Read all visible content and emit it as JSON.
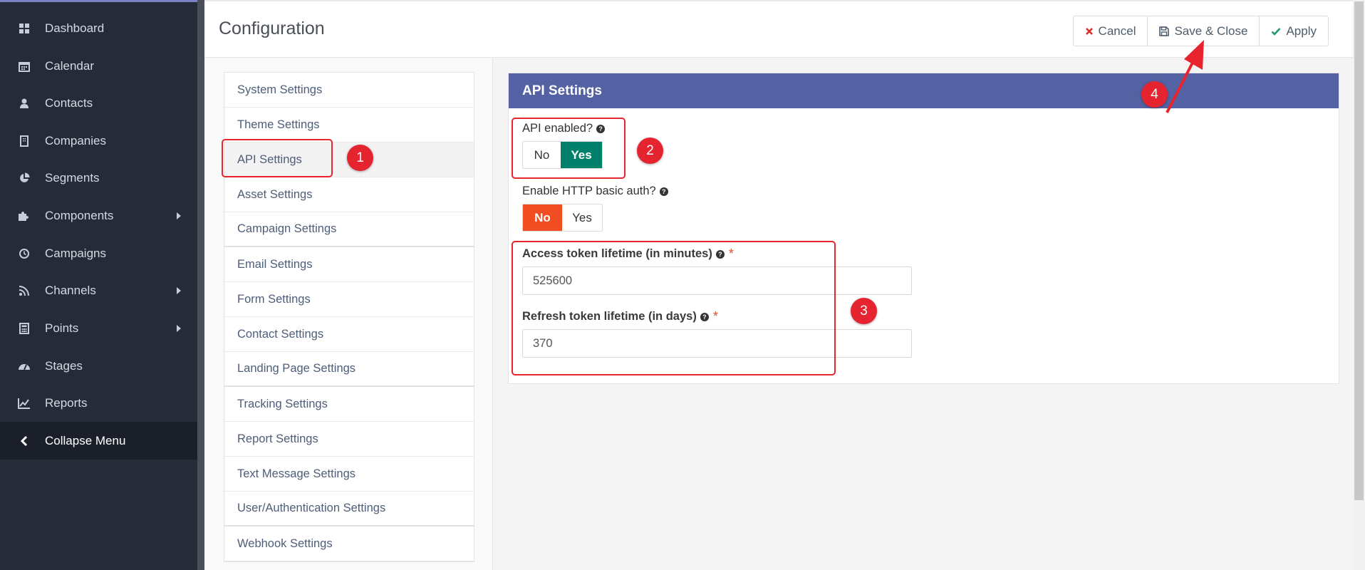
{
  "sidebar": {
    "items": [
      {
        "label": "Dashboard",
        "icon": "dashboard-icon"
      },
      {
        "label": "Calendar",
        "icon": "calendar-icon"
      },
      {
        "label": "Contacts",
        "icon": "user-icon"
      },
      {
        "label": "Companies",
        "icon": "building-icon"
      },
      {
        "label": "Segments",
        "icon": "pie-chart-icon"
      },
      {
        "label": "Components",
        "icon": "puzzle-icon"
      },
      {
        "label": "Campaigns",
        "icon": "clock-icon"
      },
      {
        "label": "Channels",
        "icon": "rss-icon"
      },
      {
        "label": "Points",
        "icon": "calculator-icon"
      },
      {
        "label": "Stages",
        "icon": "tachometer-icon"
      },
      {
        "label": "Reports",
        "icon": "line-chart-icon"
      }
    ],
    "collapse_label": "Collapse Menu"
  },
  "header": {
    "title": "Configuration",
    "cancel_label": "Cancel",
    "save_close_label": "Save & Close",
    "apply_label": "Apply"
  },
  "settings_nav": {
    "items": [
      "System Settings",
      "Theme Settings",
      "API Settings",
      "Asset Settings",
      "Campaign Settings",
      "Email Settings",
      "Form Settings",
      "Contact Settings",
      "Landing Page Settings",
      "Tracking Settings",
      "Report Settings",
      "Text Message Settings",
      "User/Authentication Settings",
      "Webhook Settings"
    ],
    "active": "API Settings"
  },
  "api_panel": {
    "title": "API Settings",
    "api_enabled": {
      "label": "API enabled?",
      "no": "No",
      "yes": "Yes",
      "selected": "Yes"
    },
    "basic_auth": {
      "label": "Enable HTTP basic auth?",
      "no": "No",
      "yes": "Yes",
      "selected": "No"
    },
    "access_token": {
      "label": "Access token lifetime (in minutes)",
      "required_mark": "*",
      "value": "525600"
    },
    "refresh_token": {
      "label": "Refresh token lifetime (in days)",
      "required_mark": "*",
      "value": "370"
    }
  },
  "annotations": {
    "one": "1",
    "two": "2",
    "three": "3",
    "four": "4"
  },
  "colors": {
    "sidebar_bg": "#262b39",
    "panel_header": "#5462a3",
    "yes_active": "#00806a",
    "no_active": "#f04d23",
    "annotation": "#e5242f"
  }
}
